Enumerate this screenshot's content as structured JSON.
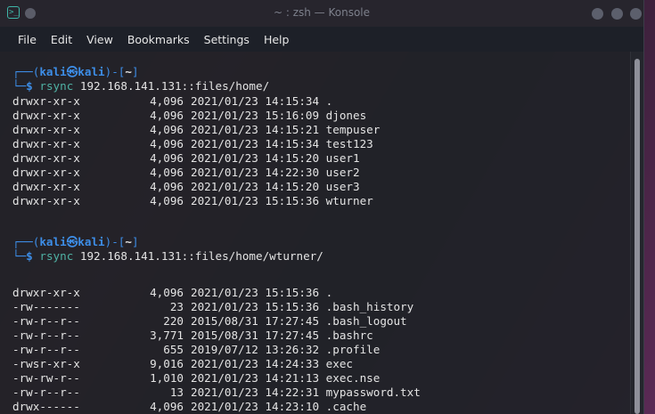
{
  "window": {
    "title": "~ : zsh — Konsole"
  },
  "menu": [
    "File",
    "Edit",
    "View",
    "Bookmarks",
    "Settings",
    "Help"
  ],
  "prompt": {
    "user": "kali",
    "host": "kali",
    "dir": "~",
    "symbol": "$"
  },
  "commands": [
    {
      "cmd": "rsync",
      "args": "192.168.141.131::files/home/",
      "rows": [
        {
          "perm": "drwxr-xr-x",
          "size": "4,096",
          "date": "2021/01/23 14:15:34",
          "name": "."
        },
        {
          "perm": "drwxr-xr-x",
          "size": "4,096",
          "date": "2021/01/23 15:16:09",
          "name": "djones"
        },
        {
          "perm": "drwxr-xr-x",
          "size": "4,096",
          "date": "2021/01/23 14:15:21",
          "name": "tempuser"
        },
        {
          "perm": "drwxr-xr-x",
          "size": "4,096",
          "date": "2021/01/23 14:15:34",
          "name": "test123"
        },
        {
          "perm": "drwxr-xr-x",
          "size": "4,096",
          "date": "2021/01/23 14:15:20",
          "name": "user1"
        },
        {
          "perm": "drwxr-xr-x",
          "size": "4,096",
          "date": "2021/01/23 14:22:30",
          "name": "user2"
        },
        {
          "perm": "drwxr-xr-x",
          "size": "4,096",
          "date": "2021/01/23 14:15:20",
          "name": "user3"
        },
        {
          "perm": "drwxr-xr-x",
          "size": "4,096",
          "date": "2021/01/23 15:15:36",
          "name": "wturner"
        }
      ]
    },
    {
      "cmd": "rsync",
      "args": "192.168.141.131::files/home/wturner/",
      "rows": [
        {
          "perm": "drwxr-xr-x",
          "size": "4,096",
          "date": "2021/01/23 15:15:36",
          "name": "."
        },
        {
          "perm": "-rw-------",
          "size": "23",
          "date": "2021/01/23 15:15:36",
          "name": ".bash_history"
        },
        {
          "perm": "-rw-r--r--",
          "size": "220",
          "date": "2015/08/31 17:27:45",
          "name": ".bash_logout"
        },
        {
          "perm": "-rw-r--r--",
          "size": "3,771",
          "date": "2015/08/31 17:27:45",
          "name": ".bashrc"
        },
        {
          "perm": "-rw-r--r--",
          "size": "655",
          "date": "2019/07/12 13:26:32",
          "name": ".profile"
        },
        {
          "perm": "-rwsr-xr-x",
          "size": "9,016",
          "date": "2021/01/23 14:24:33",
          "name": "exec"
        },
        {
          "perm": "-rw-rw-r--",
          "size": "1,010",
          "date": "2021/01/23 14:21:13",
          "name": "exec.nse"
        },
        {
          "perm": "-rw-r--r--",
          "size": "13",
          "date": "2021/01/23 14:22:31",
          "name": "mypassword.txt"
        },
        {
          "perm": "drwx------",
          "size": "4,096",
          "date": "2021/01/23 14:23:10",
          "name": ".cache"
        }
      ]
    }
  ]
}
